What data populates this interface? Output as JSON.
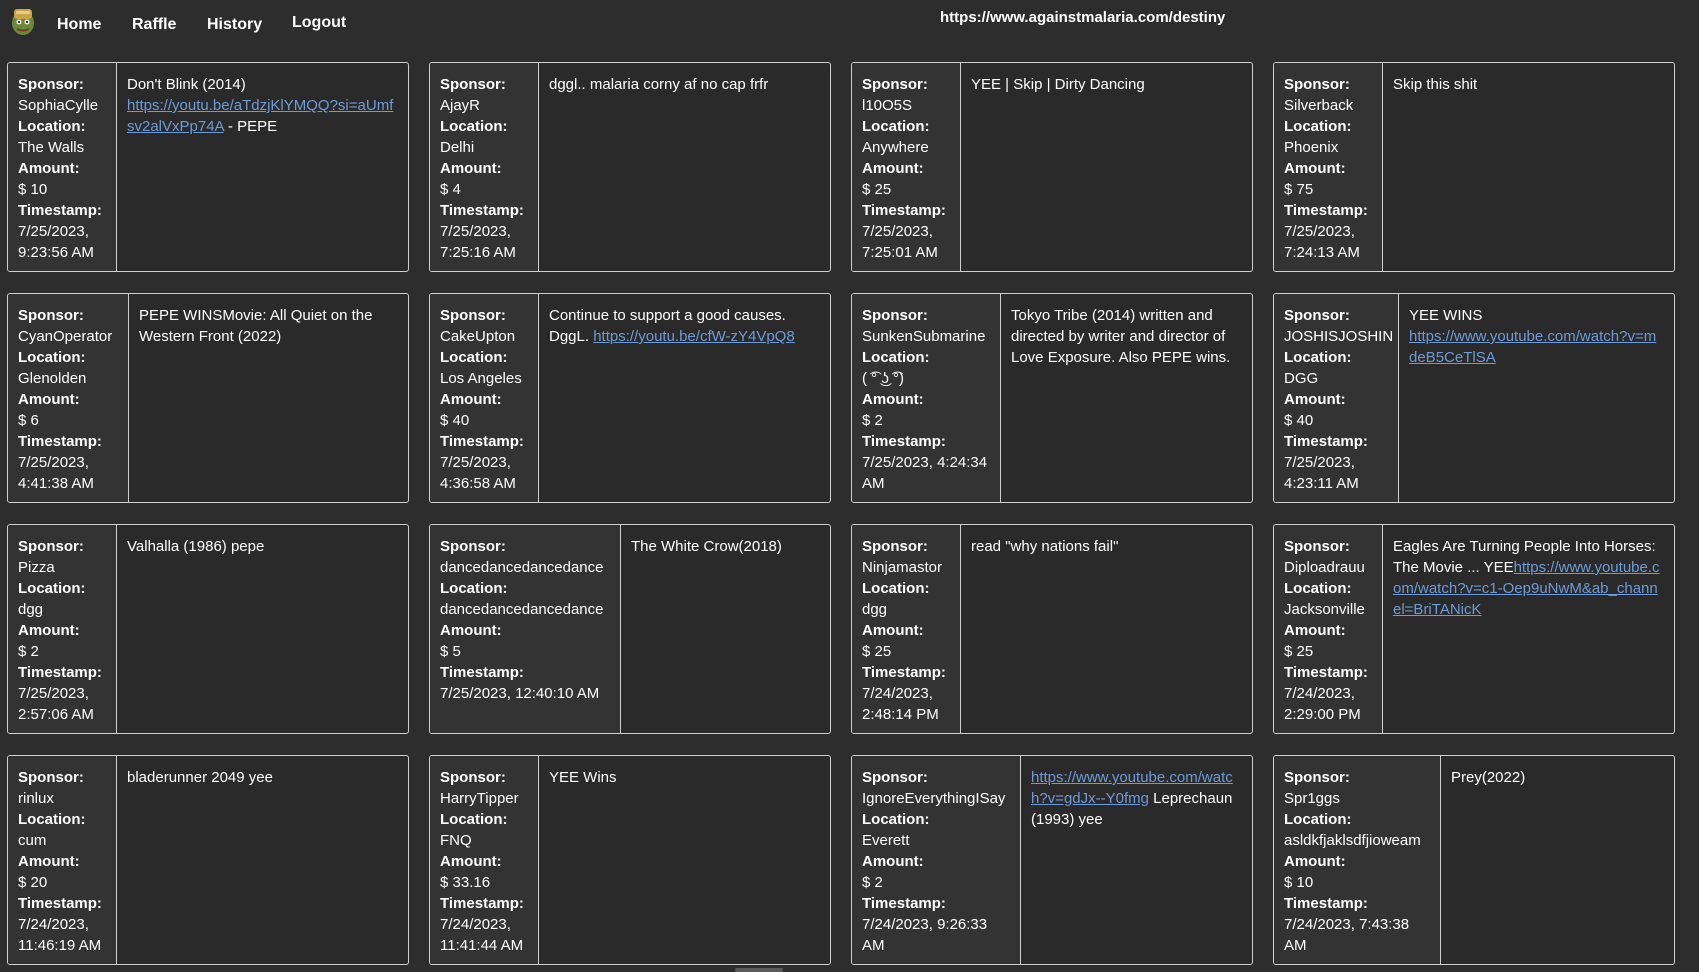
{
  "nav": {
    "home": "Home",
    "raffle": "Raffle",
    "history": "History",
    "logout": "Logout",
    "url": "https://www.againstmalaria.com/destiny"
  },
  "labels": {
    "sponsor": "Sponsor:",
    "location": "Location:",
    "amount": "Amount:",
    "timestamp": "Timestamp:"
  },
  "cards": [
    {
      "sponsor": "SophiaCylle",
      "location": "The Walls",
      "amount": "$ 10",
      "timestamp": "7/25/2023, 9:23:56 AM",
      "message": [
        {
          "t": "Don't Blink (2014)"
        },
        {
          "t": "",
          "br": true
        },
        {
          "link": "https://youtu.be/aTdzjKlYMQQ?si=aUmfsv2alVxPp74A"
        },
        {
          "t": " - PEPE"
        }
      ]
    },
    {
      "sponsor": "AjayR",
      "location": "Delhi",
      "amount": "$ 4",
      "timestamp": "7/25/2023, 7:25:16 AM",
      "message": [
        {
          "t": "dggl.. malaria corny af no cap frfr"
        }
      ]
    },
    {
      "sponsor": "l10O5S",
      "location": "Anywhere",
      "amount": "$ 25",
      "timestamp": "7/25/2023, 7:25:01 AM",
      "message": [
        {
          "t": "YEE | Skip | Dirty Dancing"
        }
      ]
    },
    {
      "sponsor": "Silverback",
      "location": "Phoenix",
      "amount": "$ 75",
      "timestamp": "7/25/2023, 7:24:13 AM",
      "message": [
        {
          "t": "Skip this shit"
        }
      ]
    },
    {
      "sponsor": "CyanOperator",
      "location": "Glenolden",
      "amount": "$ 6",
      "timestamp": "7/25/2023, 4:41:38 AM",
      "message": [
        {
          "t": "PEPE WINSMovie: All Quiet on the Western Front (2022)"
        }
      ]
    },
    {
      "sponsor": "CakeUpton",
      "location": "Los Angeles",
      "amount": "$ 40",
      "timestamp": "7/25/2023, 4:36:58 AM",
      "message": [
        {
          "t": "Continue to support a good causes. DggL. "
        },
        {
          "link": "https://youtu.be/cfW-zY4VpQ8"
        }
      ]
    },
    {
      "sponsor": "SunkenSubmarine",
      "location": "( ͡° ͜ʖ ͡°)",
      "amount": "$ 2",
      "timestamp": "7/25/2023, 4:24:34 AM",
      "message": [
        {
          "t": "Tokyo Tribe (2014) written and directed by writer and director of Love Exposure. Also PEPE wins."
        }
      ]
    },
    {
      "sponsor": "JOSHISJOSHIN",
      "location": "DGG",
      "amount": "$ 40",
      "timestamp": "7/25/2023, 4:23:11 AM",
      "message": [
        {
          "t": "YEE WINS"
        },
        {
          "t": "",
          "br": true
        },
        {
          "link": "https://www.youtube.com/watch?v=mdeB5CeTlSA"
        }
      ]
    },
    {
      "sponsor": "Pizza",
      "location": "dgg",
      "amount": "$ 2",
      "timestamp": "7/25/2023, 2:57:06 AM",
      "message": [
        {
          "t": "Valhalla (1986) pepe"
        }
      ]
    },
    {
      "sponsor": "dancedancedancedance",
      "location": "dancedancedancedance",
      "amount": "$ 5",
      "timestamp": "7/25/2023, 12:40:10 AM",
      "message": [
        {
          "t": "The White Crow(2018)"
        }
      ]
    },
    {
      "sponsor": "Ninjamastor",
      "location": "dgg",
      "amount": "$ 25",
      "timestamp": "7/24/2023, 2:48:14 PM",
      "message": [
        {
          "t": "read \"why nations fail\""
        }
      ]
    },
    {
      "sponsor": "Diploadrauu",
      "location": "Jacksonville",
      "amount": "$ 25",
      "timestamp": "7/24/2023, 2:29:00 PM",
      "message": [
        {
          "t": "Eagles Are Turning People Into Horses: The Movie ... YEE"
        },
        {
          "link": "https://www.youtube.com/watch?v=c1-Oep9uNwM&ab_channel=BriTANicK"
        }
      ]
    },
    {
      "sponsor": "rinlux",
      "location": "cum",
      "amount": "$ 20",
      "timestamp": "7/24/2023, 11:46:19 AM",
      "message": [
        {
          "t": "bladerunner 2049 yee"
        }
      ]
    },
    {
      "sponsor": "HarryTipper",
      "location": "FNQ",
      "amount": "$ 33.16",
      "timestamp": "7/24/2023, 11:41:44 AM",
      "message": [
        {
          "t": "YEE Wins"
        }
      ]
    },
    {
      "sponsor": "IgnoreEverythingISay",
      "location": "Everett",
      "amount": "$ 2",
      "timestamp": "7/24/2023, 9:26:33 AM",
      "message": [
        {
          "link": "https://www.youtube.com/watch?v=gdJx--Y0fmg"
        },
        {
          "t": " Leprechaun (1993) yee"
        }
      ]
    },
    {
      "sponsor": "Spr1ggs",
      "location": "asldkfjaklsdfjioweam",
      "amount": "$ 10",
      "timestamp": "7/24/2023, 7:43:38 AM",
      "message": [
        {
          "t": "Prey(2022)"
        }
      ]
    }
  ]
}
